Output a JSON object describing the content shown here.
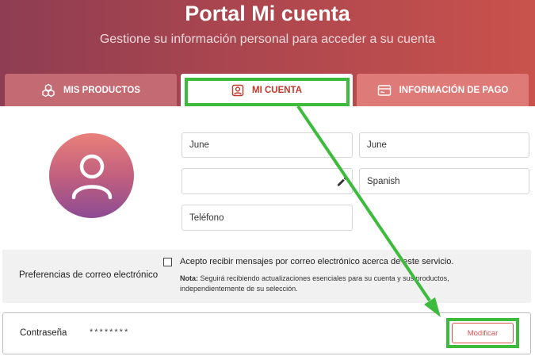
{
  "header": {
    "title": "Portal Mi cuenta",
    "subtitle": "Gestione su información personal para acceder a su cuenta"
  },
  "tabs": [
    {
      "label": "MIS PRODUCTOS",
      "icon": "cubes-icon",
      "active": false
    },
    {
      "label": "MI CUENTA",
      "icon": "user-badge-icon",
      "active": true
    },
    {
      "label": "INFORMACIÓN DE PAGO",
      "icon": "payment-card-icon",
      "active": false
    }
  ],
  "profile": {
    "first_name": "June",
    "last_name": "June",
    "email": "",
    "language": "Spanish",
    "phone_placeholder": "Teléfono"
  },
  "email_preferences": {
    "label": "Preferencias de correo electrónico",
    "checkbox_label": "Acepto recibir mensajes por correo electrónico acerca de este servicio.",
    "checked": false,
    "note_prefix": "Nota:",
    "note_text": " Seguirá recibiendo actualizaciones esenciales para su cuenta y sus productos, independientemente de su selección."
  },
  "password": {
    "label": "Contraseña",
    "masked": "********",
    "modify_label": "Modificar"
  },
  "colors": {
    "accent": "#c0392b",
    "highlight": "#3dbb3d"
  }
}
